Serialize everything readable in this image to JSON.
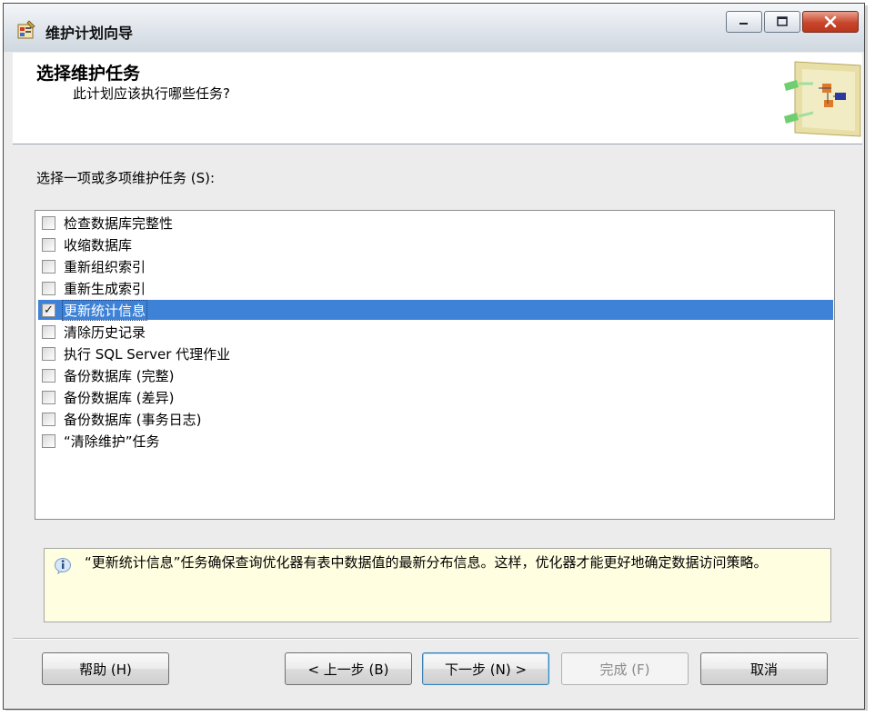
{
  "window": {
    "title": "维护计划向导"
  },
  "header": {
    "title": "选择维护任务",
    "subtitle": "此计划应该执行哪些任务?"
  },
  "select_label": "选择一项或多项维护任务 (S):",
  "tasks": [
    {
      "label": "检查数据库完整性",
      "checked": false,
      "selected": false
    },
    {
      "label": "收缩数据库",
      "checked": false,
      "selected": false
    },
    {
      "label": "重新组织索引",
      "checked": false,
      "selected": false
    },
    {
      "label": "重新生成索引",
      "checked": false,
      "selected": false
    },
    {
      "label": "更新统计信息",
      "checked": true,
      "selected": true
    },
    {
      "label": "清除历史记录",
      "checked": false,
      "selected": false
    },
    {
      "label": "执行 SQL Server 代理作业",
      "checked": false,
      "selected": false
    },
    {
      "label": "备份数据库 (完整)",
      "checked": false,
      "selected": false
    },
    {
      "label": "备份数据库 (差异)",
      "checked": false,
      "selected": false
    },
    {
      "label": "备份数据库 (事务日志)",
      "checked": false,
      "selected": false
    },
    {
      "label": "“清除维护”任务",
      "checked": false,
      "selected": false
    }
  ],
  "info": {
    "text": "“更新统计信息”任务确保查询优化器有表中数据值的最新分布信息。这样，优化器才能更好地确定数据访问策略。"
  },
  "buttons": {
    "help": "帮助 (H)",
    "back": "< 上一步 (B)",
    "next": "下一步 (N) >",
    "finish": "完成 (F)",
    "cancel": "取消"
  },
  "icons": {
    "app": "wizard-app-icon",
    "minimize": "minimize-icon",
    "maximize": "maximize-icon",
    "close": "close-icon",
    "info": "info-icon",
    "header_art": "maintenance-plan-illustration"
  },
  "colors": {
    "selection": "#3d82d7",
    "info_background": "#fffee1",
    "close_button": "#c8452b"
  }
}
